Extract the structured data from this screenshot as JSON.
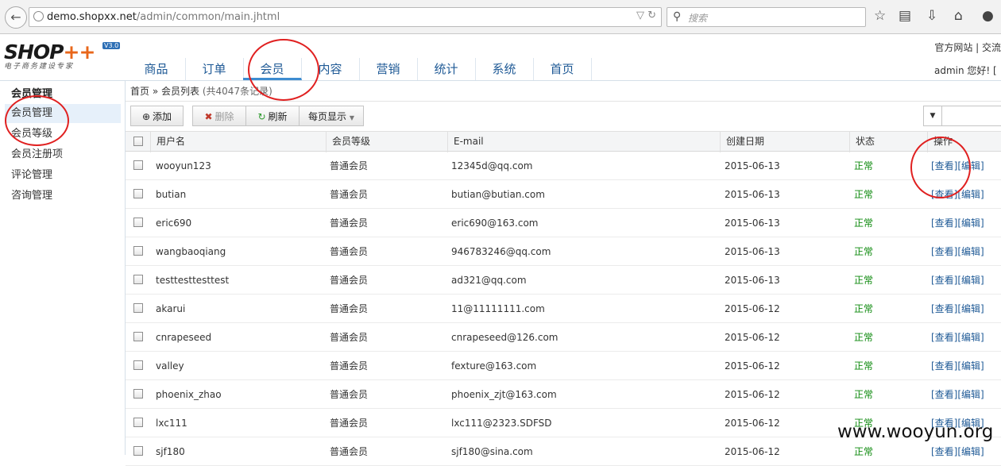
{
  "browser": {
    "url_host": "demo.shopxx.net",
    "url_path": "/admin/common/main.jhtml",
    "search_placeholder": "搜索"
  },
  "logo": {
    "text": "SHOP",
    "plus": "++",
    "version": "V3.0",
    "tagline": "电子商务建设专家"
  },
  "nav": {
    "items": [
      "商品",
      "订单",
      "会员",
      "内容",
      "营销",
      "统计",
      "系统",
      "首页"
    ],
    "active": "会员"
  },
  "header": {
    "links": "官方网站 | 交流",
    "user": "admin 您好! ["
  },
  "sidebar": {
    "title": "会员管理",
    "items": [
      "会员管理",
      "会员等级",
      "会员注册项",
      "评论管理",
      "咨询管理"
    ],
    "active": "会员管理"
  },
  "breadcrumb": {
    "home": "首页",
    "sep": "»",
    "current": "会员列表",
    "count": "(共4047条记录)"
  },
  "toolbar": {
    "add": "添加",
    "delete": "删除",
    "refresh": "刷新",
    "page_size": "每页显示"
  },
  "table": {
    "columns": [
      "用户名",
      "会员等级",
      "E-mail",
      "创建日期",
      "状态",
      "操作"
    ],
    "view_label": "[查看]",
    "edit_label": "[编辑]",
    "rows": [
      {
        "username": "wooyun123",
        "level": "普通会员",
        "email": "12345d@qq.com",
        "date": "2015-06-13",
        "status": "正常"
      },
      {
        "username": "butian",
        "level": "普通会员",
        "email": "butian@butian.com",
        "date": "2015-06-13",
        "status": "正常"
      },
      {
        "username": "eric690",
        "level": "普通会员",
        "email": "eric690@163.com",
        "date": "2015-06-13",
        "status": "正常"
      },
      {
        "username": "wangbaoqiang",
        "level": "普通会员",
        "email": "946783246@qq.com",
        "date": "2015-06-13",
        "status": "正常"
      },
      {
        "username": "testtesttesttest",
        "level": "普通会员",
        "email": "ad321@qq.com",
        "date": "2015-06-13",
        "status": "正常"
      },
      {
        "username": "akarui",
        "level": "普通会员",
        "email": "11@11111111.com",
        "date": "2015-06-12",
        "status": "正常"
      },
      {
        "username": "cnrapeseed",
        "level": "普通会员",
        "email": "cnrapeseed@126.com",
        "date": "2015-06-12",
        "status": "正常"
      },
      {
        "username": "valley",
        "level": "普通会员",
        "email": "fexture@163.com",
        "date": "2015-06-12",
        "status": "正常"
      },
      {
        "username": "phoenix_zhao",
        "level": "普通会员",
        "email": "phoenix_zjt@163.com",
        "date": "2015-06-12",
        "status": "正常"
      },
      {
        "username": "lxc111",
        "level": "普通会员",
        "email": "lxc111@2323.SDFSD",
        "date": "2015-06-12",
        "status": "正常"
      },
      {
        "username": "sjf180",
        "level": "普通会员",
        "email": "sjf180@sina.com",
        "date": "2015-06-12",
        "status": "正常"
      }
    ]
  },
  "watermark": "www.wooyun.org",
  "colors": {
    "nav_text": "#1f5a96",
    "status_ok": "#0e8a0e",
    "annotation": "#e02020",
    "logo_plus": "#e8661a"
  }
}
